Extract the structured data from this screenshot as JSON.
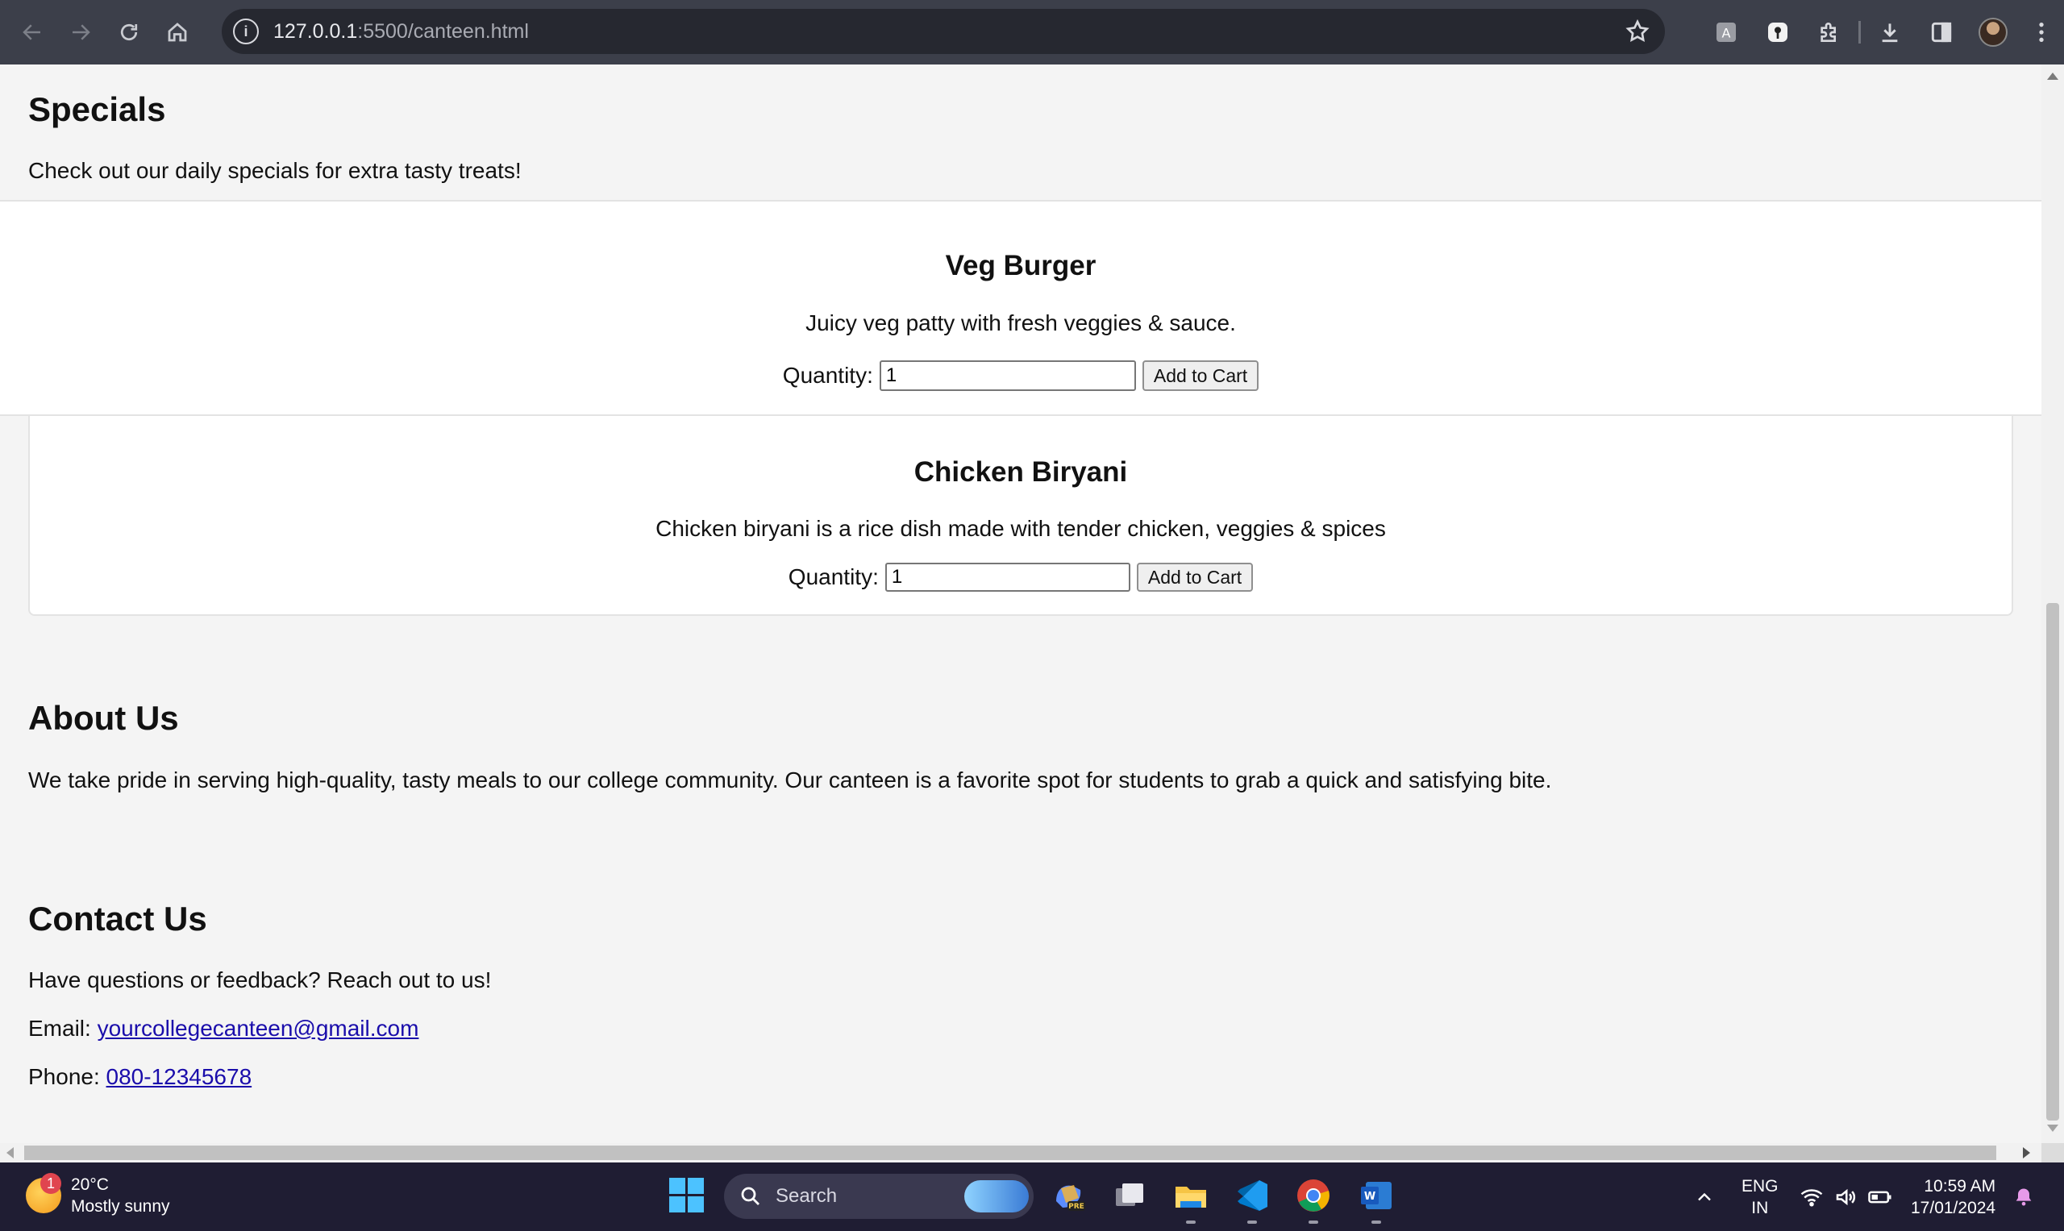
{
  "browser": {
    "url_host": "127.0.0.1",
    "url_path": ":5500/canteen.html"
  },
  "specials": {
    "title": "Specials",
    "subtitle": "Check out our daily specials for extra tasty treats!"
  },
  "items": [
    {
      "name": "Veg Burger",
      "description": "Juicy veg patty with fresh veggies & sauce.",
      "quantity_label": "Quantity:",
      "quantity_value": "1",
      "button": "Add to Cart"
    },
    {
      "name": "Chicken Biryani",
      "description": "Chicken biryani is a rice dish made with tender chicken, veggies & spices",
      "quantity_label": "Quantity:",
      "quantity_value": "1",
      "button": "Add to Cart"
    }
  ],
  "about": {
    "title": "About Us",
    "text": "We take pride in serving high-quality, tasty meals to our college community. Our canteen is a favorite spot for students to grab a quick and satisfying bite."
  },
  "contact": {
    "title": "Contact Us",
    "intro": "Have questions or feedback? Reach out to us!",
    "email_label": "Email:",
    "email": "yourcollegecanteen@gmail.com",
    "phone_label": "Phone:",
    "phone": "080-12345678"
  },
  "taskbar": {
    "weather_badge": "1",
    "temperature": "20°C",
    "weather": "Mostly sunny",
    "search_label": "Search",
    "language_line1": "ENG",
    "language_line2": "IN",
    "time": "10:59 AM",
    "date": "17/01/2024"
  },
  "colors": {
    "browser_bar": "#3c3f4a",
    "page_bg": "#f4f4f4",
    "link": "#1a0dab",
    "taskbar": "#1f1d33"
  }
}
